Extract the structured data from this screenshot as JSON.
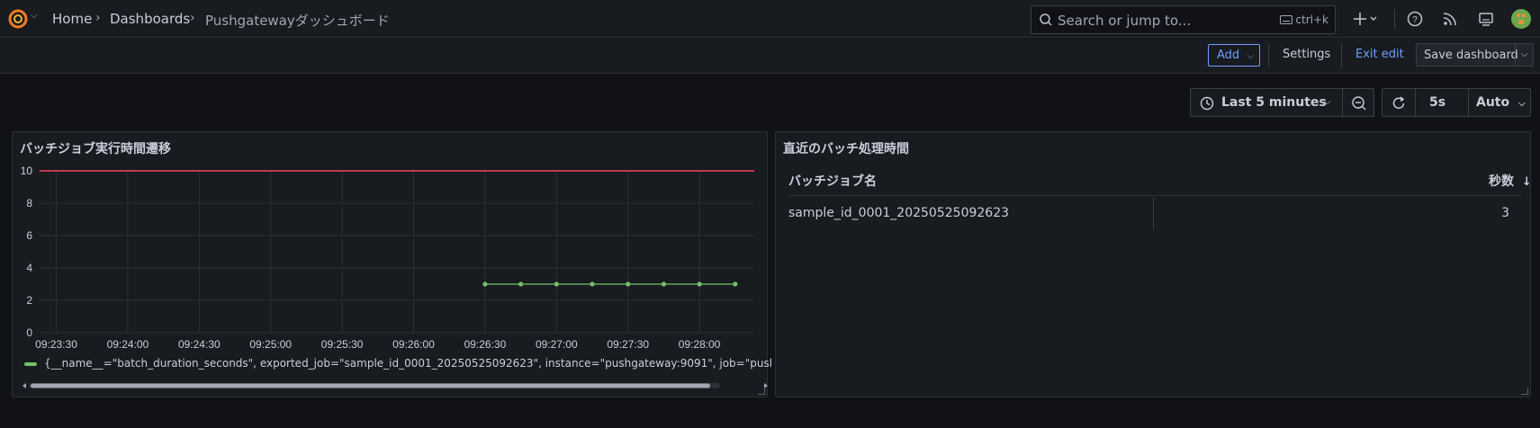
{
  "topbar": {
    "breadcrumbs": [
      "Home",
      "Dashboards",
      "Pushgatewayダッシュボード"
    ],
    "search": {
      "placeholder": "Search or jump to...",
      "shortcut": "ctrl+k"
    },
    "icons": [
      "grafana-logo-icon",
      "plus-icon",
      "help-icon",
      "news-rss-icon",
      "kiosk-icon",
      "avatar"
    ]
  },
  "toolbar": {
    "add_label": "Add",
    "settings_label": "Settings",
    "exit_edit_label": "Exit edit",
    "save_label": "Save dashboard"
  },
  "timecontrols": {
    "range_label": "Last 5 minutes",
    "refresh_interval": "5s",
    "auto_label": "Auto"
  },
  "colors": {
    "accent": "#6e9fff",
    "series": "#73bf69",
    "threshold": "#f2495c"
  },
  "panels": {
    "timeseries": {
      "title": "バッチジョブ実行時間遷移",
      "legend": "{__name__=\"batch_duration_seconds\", exported_job=\"sample_id_0001_20250525092623\", instance=\"pushgateway:9091\", job=\"pushgate"
    },
    "table": {
      "title": "直近のバッチ処理時間",
      "columns": [
        "バッチジョブ名",
        "秒数"
      ],
      "sort_column": "秒数",
      "sort_direction": "descending",
      "rows": [
        {
          "name": "sample_id_0001_20250525092623",
          "seconds": "3"
        }
      ]
    }
  },
  "chart_data": {
    "type": "line",
    "x_ticks": [
      "09:23:30",
      "09:24:00",
      "09:24:30",
      "09:25:00",
      "09:25:30",
      "09:26:00",
      "09:26:30",
      "09:27:00",
      "09:27:30",
      "09:28:00"
    ],
    "y_ticks": [
      "0",
      "2",
      "4",
      "6",
      "8",
      "10"
    ],
    "ylim": [
      0,
      10
    ],
    "xlim": [
      "09:23:23",
      "09:28:23"
    ],
    "grid": true,
    "legend_position": "bottom",
    "series": [
      {
        "points": [
          [
            "09:26:30",
            3
          ],
          [
            "09:26:45",
            3
          ],
          [
            "09:27:00",
            3
          ],
          [
            "09:27:15",
            3
          ],
          [
            "09:27:30",
            3
          ],
          [
            "09:27:45",
            3
          ],
          [
            "09:28:00",
            3
          ],
          [
            "09:28:15",
            3
          ]
        ],
        "color": "#73bf69"
      }
    ],
    "threshold": {
      "value": 10,
      "color": "#f2495c"
    }
  }
}
